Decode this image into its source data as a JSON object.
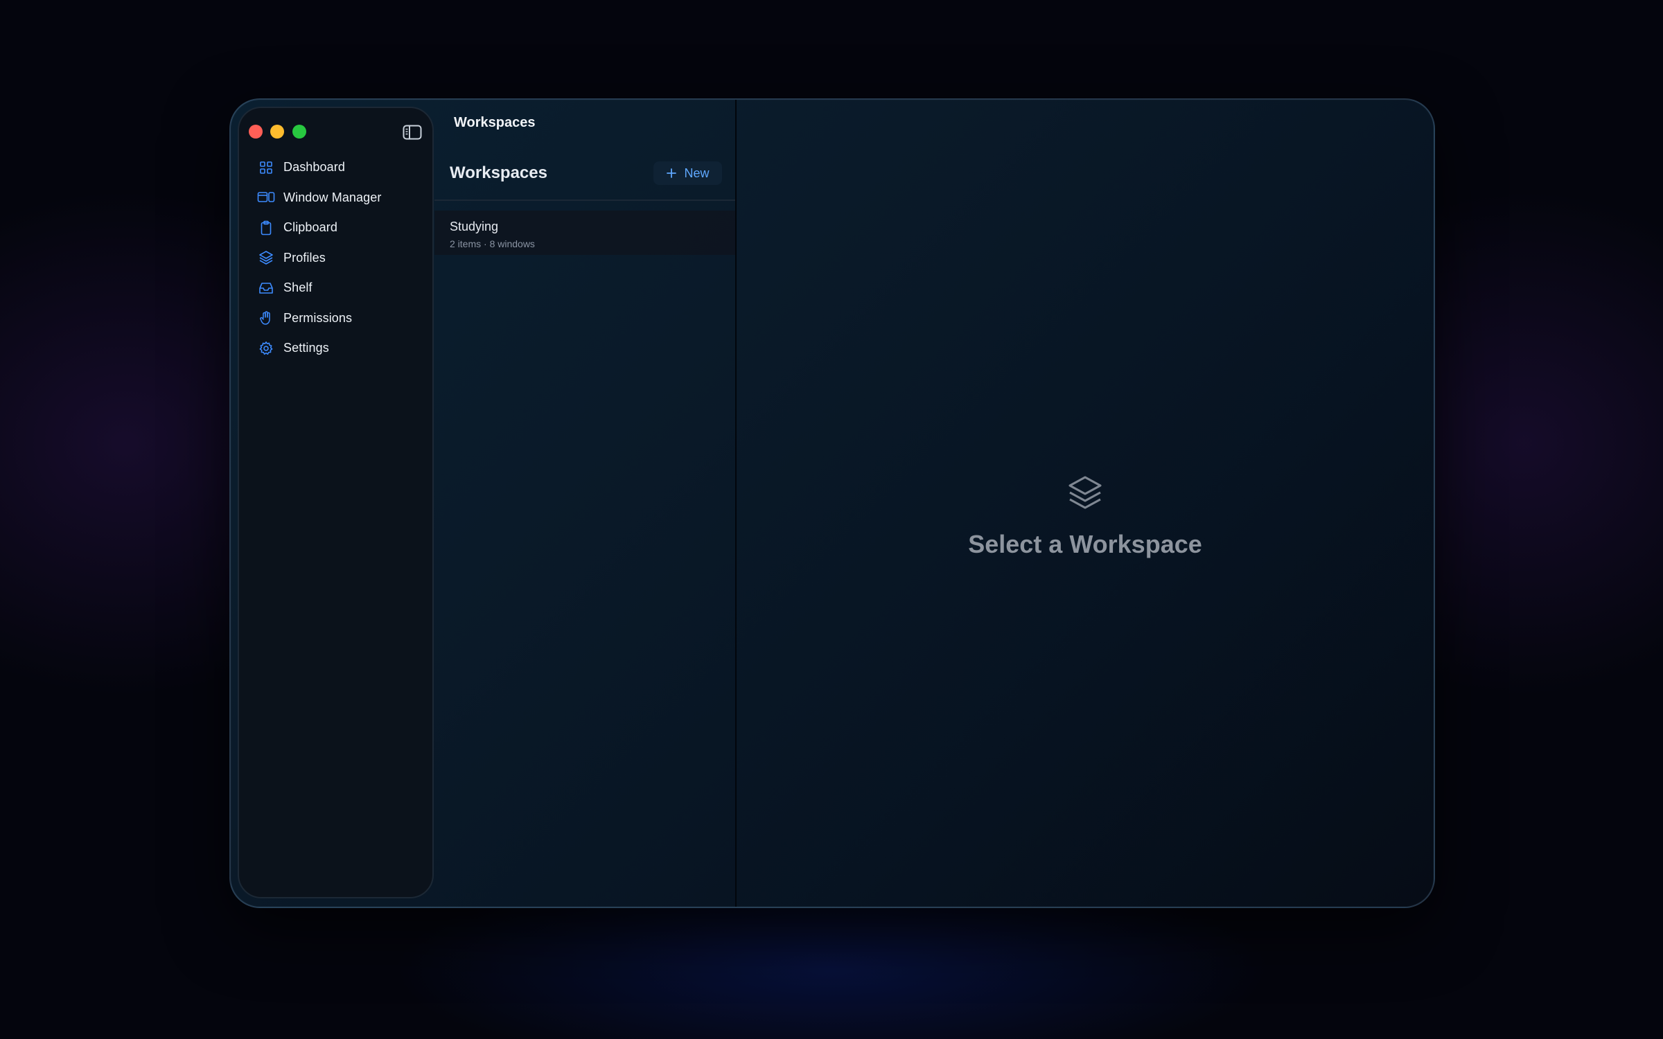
{
  "window": {
    "toolbar_title": "Workspaces"
  },
  "sidebar": {
    "toggle_icon": "sidebar-toggle-icon",
    "items": [
      {
        "label": "Dashboard",
        "icon": "grid-icon"
      },
      {
        "label": "Window Manager",
        "icon": "window-manager-icon"
      },
      {
        "label": "Clipboard",
        "icon": "clipboard-icon"
      },
      {
        "label": "Profiles",
        "icon": "layers-icon"
      },
      {
        "label": "Shelf",
        "icon": "tray-icon"
      },
      {
        "label": "Permissions",
        "icon": "hand-icon"
      },
      {
        "label": "Settings",
        "icon": "gear-icon"
      }
    ],
    "icon_color": "#3d8bff"
  },
  "list": {
    "header": "Workspaces",
    "new_label": "New",
    "items": [
      {
        "title": "Studying",
        "subtitle": "2 items · 8 windows"
      }
    ]
  },
  "detail": {
    "empty_title": "Select a Workspace",
    "empty_icon": "layers-icon"
  },
  "colors": {
    "accent": "#5fa8ff",
    "close": "#ff5f57",
    "minimize": "#febc2e",
    "maximize": "#28c840"
  }
}
